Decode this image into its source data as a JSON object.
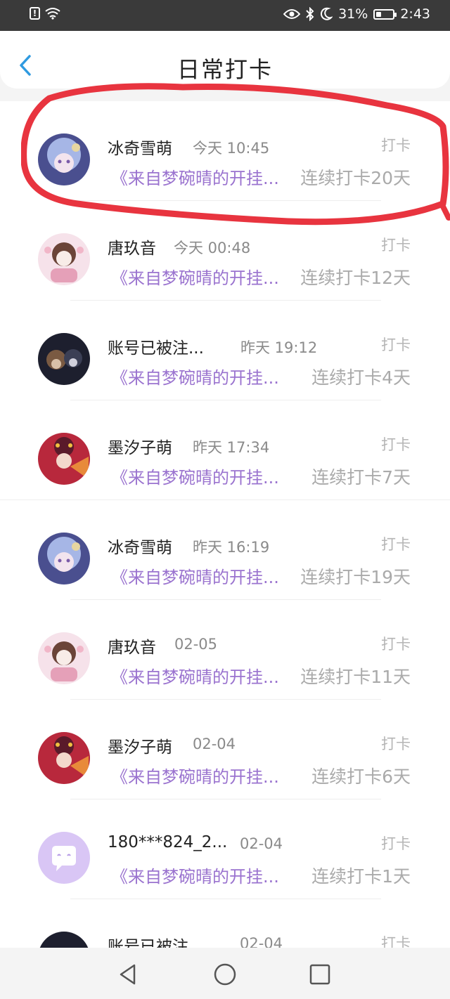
{
  "status_bar": {
    "battery": "31%",
    "time": "2:43"
  },
  "header": {
    "title": "日常打卡"
  },
  "list": {
    "items": [
      {
        "name": "冰奇雪萌",
        "time": "今天 10:45",
        "action": "打卡",
        "source": "《来自梦碗晴的开挂...",
        "streak": "连续打卡20天",
        "avatar": "avatar-blue-girl"
      },
      {
        "name": "唐玖音",
        "time": "今天 00:48",
        "action": "打卡",
        "source": "《来自梦碗晴的开挂...",
        "streak": "连续打卡12天",
        "avatar": "avatar-pink-girl"
      },
      {
        "name": "账号已被注...",
        "time": "昨天 19:12",
        "action": "打卡",
        "source": "《来自梦碗晴的开挂...",
        "streak": "连续打卡4天",
        "avatar": "avatar-dark-boy"
      },
      {
        "name": "墨汐子萌",
        "time": "昨天 17:34",
        "action": "打卡",
        "source": "《来自梦碗晴的开挂...",
        "streak": "连续打卡7天",
        "avatar": "avatar-red-opera"
      },
      {
        "name": "冰奇雪萌",
        "time": "昨天 16:19",
        "action": "打卡",
        "source": "《来自梦碗晴的开挂...",
        "streak": "连续打卡19天",
        "avatar": "avatar-blue-girl"
      },
      {
        "name": "唐玖音",
        "time": "02-05",
        "action": "打卡",
        "source": "《来自梦碗晴的开挂...",
        "streak": "连续打卡11天",
        "avatar": "avatar-pink-girl"
      },
      {
        "name": "墨汐子萌",
        "time": "02-04",
        "action": "打卡",
        "source": "《来自梦碗晴的开挂...",
        "streak": "连续打卡6天",
        "avatar": "avatar-red-opera"
      },
      {
        "name": "180***824_2...",
        "time": "02-04",
        "action": "打卡",
        "source": "《来自梦碗晴的开挂...",
        "streak": "连续打卡1天",
        "avatar": "avatar-default-chat"
      },
      {
        "name": "账号已被注...",
        "time": "02-04",
        "action": "打卡",
        "source": "",
        "streak": "",
        "avatar": "avatar-dark-boy"
      }
    ]
  },
  "colors": {
    "status_bg": "#3a3a3a",
    "accent_blue": "#2f9ae0",
    "source_purple": "#9a73cf",
    "annotation_red": "#e8343f"
  }
}
